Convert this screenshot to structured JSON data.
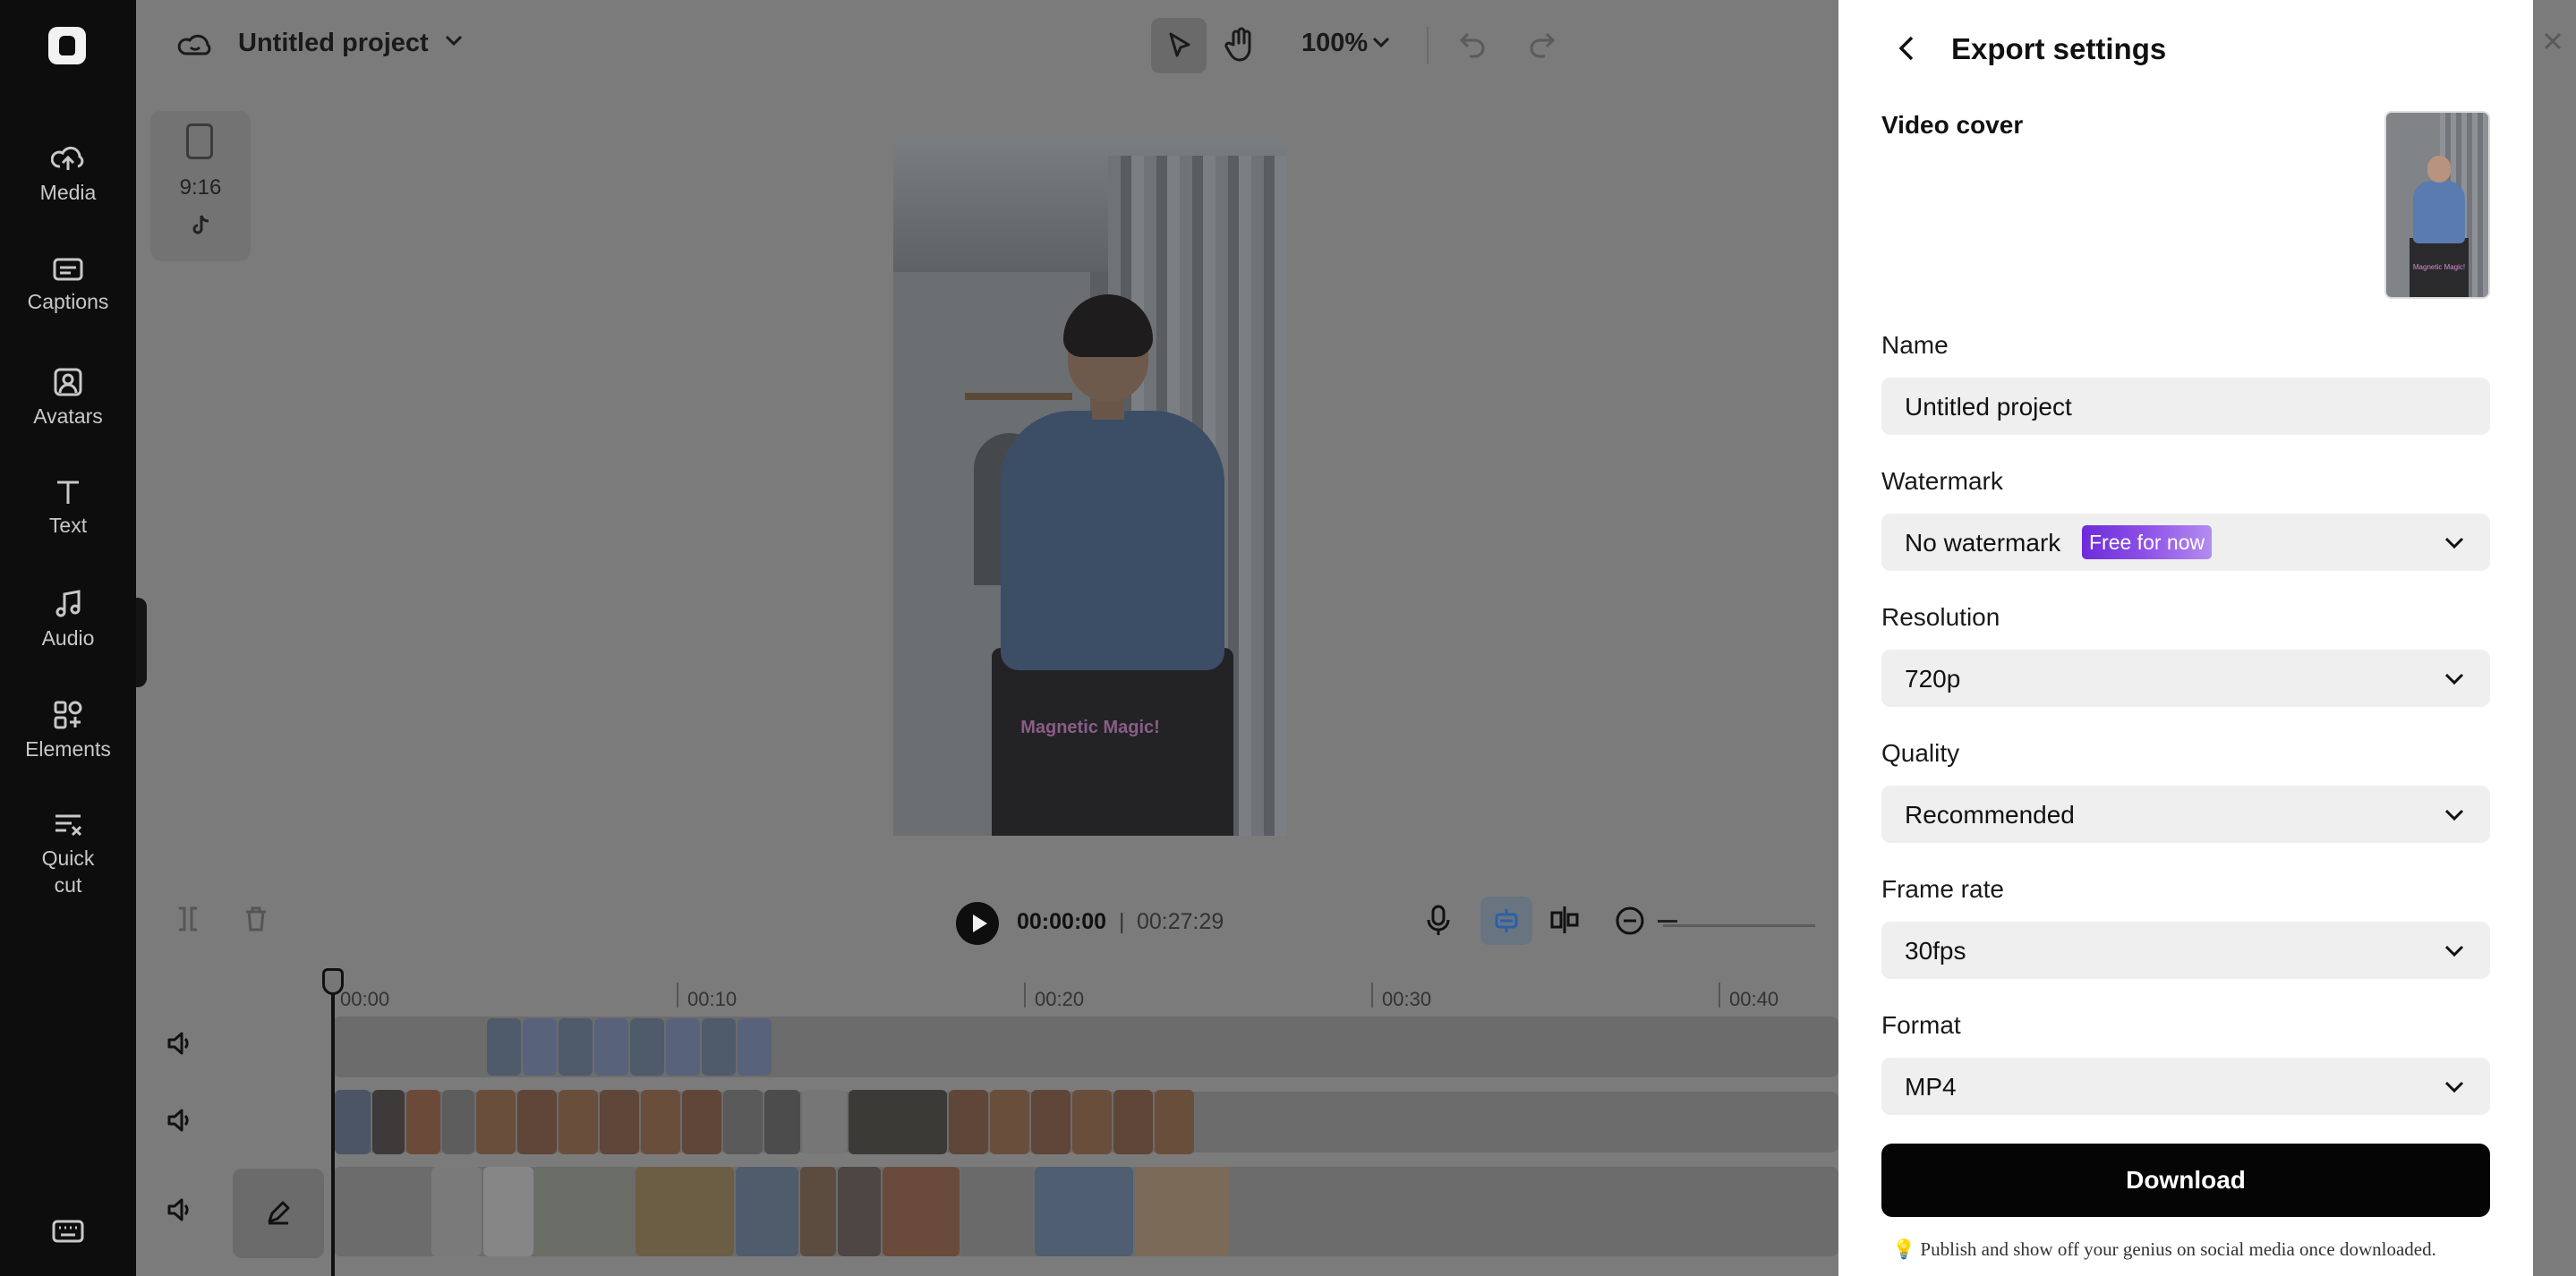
{
  "rail": {
    "items": [
      {
        "label": "Media",
        "icon": "cloud-upload-icon"
      },
      {
        "label": "Captions",
        "icon": "captions-icon"
      },
      {
        "label": "Avatars",
        "icon": "avatar-icon"
      },
      {
        "label": "Text",
        "icon": "text-icon"
      },
      {
        "label": "Audio",
        "icon": "music-note-icon"
      },
      {
        "label": "Elements",
        "icon": "elements-icon"
      },
      {
        "label": "Quick cut",
        "icon": "quick-cut-icon"
      }
    ]
  },
  "topbar": {
    "project_title": "Untitled project",
    "zoom": "100%"
  },
  "canvas": {
    "aspect_ratio": "9:16",
    "video_caption": "Magnetic Magic!"
  },
  "transport": {
    "current_time": "00:00:00",
    "separator": "|",
    "total_time": "00:27:29"
  },
  "timeline": {
    "ruler": [
      "00:00",
      "00:10",
      "00:20",
      "00:30",
      "00:40"
    ]
  },
  "export": {
    "title": "Export settings",
    "video_cover_label": "Video cover",
    "name_label": "Name",
    "name_value": "Untitled project",
    "watermark_label": "Watermark",
    "watermark_value": "No watermark",
    "watermark_badge": "Free for now",
    "resolution_label": "Resolution",
    "resolution_value": "720p",
    "quality_label": "Quality",
    "quality_value": "Recommended",
    "framerate_label": "Frame rate",
    "framerate_value": "30fps",
    "format_label": "Format",
    "format_value": "MP4",
    "download_label": "Download",
    "footnote": "💡 Publish and show off your genius on social media once downloaded."
  },
  "colors": {
    "accent_badge": "#7a3ce0",
    "download_bg": "#050505",
    "rail_bg": "#0d0d0d",
    "overlay": "#7b7b7b"
  }
}
